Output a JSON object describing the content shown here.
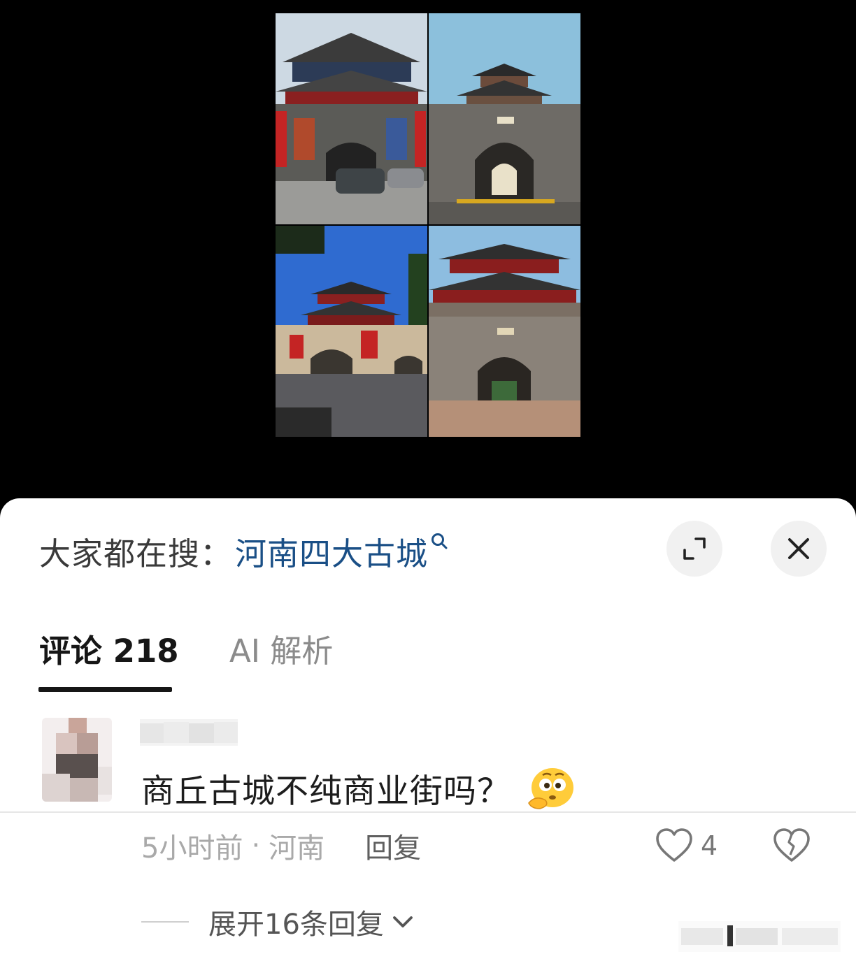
{
  "photo": {
    "tiles": [
      {
        "icon": "city-gate-photo-1"
      },
      {
        "icon": "city-gate-photo-2"
      },
      {
        "icon": "city-gate-photo-3"
      },
      {
        "icon": "city-gate-photo-4"
      }
    ]
  },
  "header": {
    "search_prefix": "大家都在搜：",
    "search_term": "河南四大古城",
    "expand_icon": "expand-icon",
    "close_icon": "close-icon"
  },
  "tabs": [
    {
      "label": "评论 218",
      "active": true
    },
    {
      "label": "AI 解析",
      "active": false
    }
  ],
  "comment": {
    "text": "商丘古城不纯商业街吗？",
    "emoji": "thinking-face-emoji",
    "time": "5小时前",
    "separator": "·",
    "location": "河南",
    "reply_label": "回复",
    "like_count": "4",
    "expand_replies": "展开16条回复"
  },
  "colors": {
    "search_term": "#1a4f86",
    "tab_active": "#161616",
    "tab_inactive": "#8b8b8b",
    "meta": "#a9a9a9"
  }
}
